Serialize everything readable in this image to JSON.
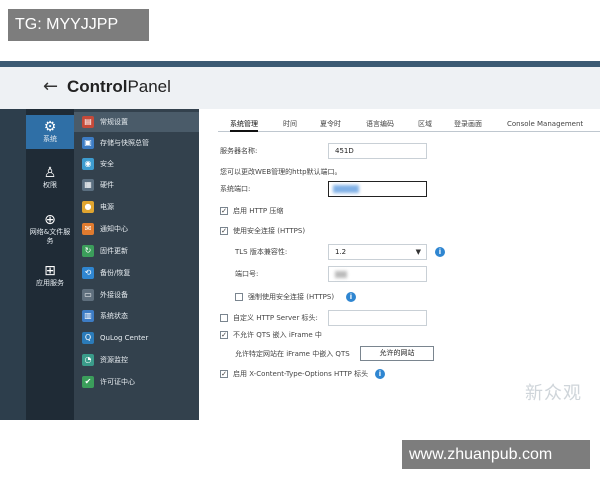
{
  "watermark_top": "TG: MYYJJPP",
  "watermark_bottom": "www.zhuanpub.com",
  "watermark_side": "新众观",
  "app": {
    "back_glyph": "←",
    "title_bold": "Control",
    "title_light": "Panel"
  },
  "rail": [
    {
      "icon": "⚙",
      "label": "系统"
    },
    {
      "icon": "♙",
      "label": "权限"
    },
    {
      "icon": "⊕",
      "label": "网络&文件服务"
    },
    {
      "icon": "⊞",
      "label": "应用服务"
    }
  ],
  "submenu": [
    {
      "label": "常规设置",
      "color": "#c64a3a",
      "glyph": "▤"
    },
    {
      "label": "存储与快照总管",
      "color": "#3d7cc4",
      "glyph": "▣"
    },
    {
      "label": "安全",
      "color": "#3d9ccf",
      "glyph": "◉"
    },
    {
      "label": "硬件",
      "color": "#5b6f80",
      "glyph": "▦"
    },
    {
      "label": "电源",
      "color": "#e0a530",
      "glyph": "●"
    },
    {
      "label": "通知中心",
      "color": "#e07b2f",
      "glyph": "✉"
    },
    {
      "label": "固件更新",
      "color": "#3b9e5b",
      "glyph": "↻"
    },
    {
      "label": "备份/恢复",
      "color": "#2f86d1",
      "glyph": "⟲"
    },
    {
      "label": "外接设备",
      "color": "#5f6f7d",
      "glyph": "▭"
    },
    {
      "label": "系统状态",
      "color": "#3d7cc4",
      "glyph": "▥"
    },
    {
      "label": "QuLog Center",
      "color": "#2b7bb9",
      "glyph": "Q"
    },
    {
      "label": "资源监控",
      "color": "#3a9c8a",
      "glyph": "◔"
    },
    {
      "label": "许可证中心",
      "color": "#3b9e5b",
      "glyph": "✔"
    }
  ],
  "tabs": [
    "系统管理",
    "时间",
    "夏令时",
    "语言编码",
    "区域",
    "登录画面",
    "Console Management"
  ],
  "form": {
    "server_name_label": "服务器名称:",
    "server_name_value": "451D",
    "hint": "您可以更改WEB管理的http默认端口。",
    "port_label": "系统端口:",
    "port_value": "",
    "http_compress": "启用 HTTP 压缩",
    "https": "使用安全连接 (HTTPS)",
    "tls_label": "TLS 版本兼容性:",
    "tls_value": "1.2",
    "tls_caret": "▼",
    "https_port_label": "端口号:",
    "https_port_value": "",
    "force_https": "强制使用安全连接 (HTTPS)",
    "custom_header": "自定义 HTTP Server 标头:",
    "iframe": "不允许 QTS 嵌入 iFrame 中",
    "allow_sites_label": "允许特定网站在 iFrame 中嵌入 QTS",
    "allow_sites_button": "允许的网站",
    "nosniff": "启用 X-Content-Type-Options HTTP 标头",
    "check_mark": "✓",
    "info_glyph": "i"
  }
}
